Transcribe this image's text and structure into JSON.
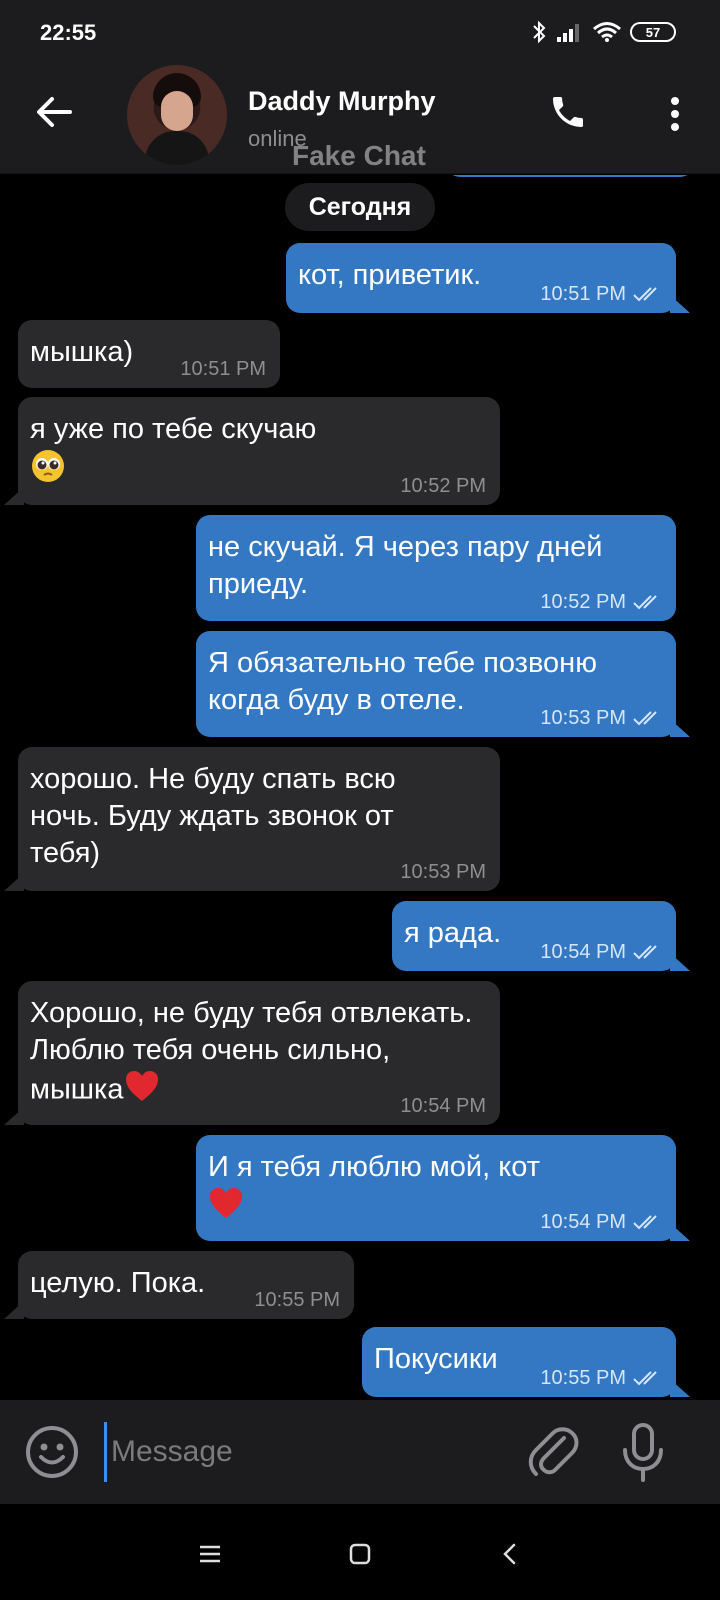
{
  "status_bar": {
    "time": "22:55",
    "battery": "57",
    "icons": [
      "bluetooth-icon",
      "signal-icon",
      "wifi-icon",
      "battery-icon"
    ]
  },
  "header": {
    "contact_name": "Daddy Murphy",
    "contact_status": "online",
    "watermark": "Fake Chat",
    "icons": [
      "back-arrow-icon",
      "phone-icon",
      "more-vert-icon"
    ]
  },
  "chat": {
    "date_label": "Сегодня",
    "colors": {
      "outgoing": "#3478c4",
      "incoming": "#2a2a2c"
    },
    "messages": [
      {
        "dir": "out",
        "text": "кот, приветик.",
        "time": "10:51 PM",
        "read": true
      },
      {
        "dir": "in",
        "text": "мышка)",
        "time": "10:51 PM"
      },
      {
        "dir": "in",
        "text": "я уже по тебе скучаю",
        "emoji": "pleading-face-emoji",
        "time": "10:52 PM"
      },
      {
        "dir": "out",
        "text": "не скучай. Я через пару дней приеду.",
        "time": "10:52 PM",
        "read": true
      },
      {
        "dir": "out",
        "text": "Я обязательно тебе позвоню когда буду в отеле.",
        "time": "10:53 PM",
        "read": true
      },
      {
        "dir": "in",
        "text": "хорошо. Не буду спать всю ночь. Буду ждать звонок от тебя)",
        "time": "10:53 PM"
      },
      {
        "dir": "out",
        "text": "я рада.",
        "time": "10:54 PM",
        "read": true
      },
      {
        "dir": "in",
        "text": "Хорошо, не буду тебя отвлекать. Люблю тебя очень сильно, мышка",
        "emoji": "red-heart-emoji",
        "time": "10:54 PM"
      },
      {
        "dir": "out",
        "text": "И я тебя люблю мой, кот",
        "emoji": "red-heart-emoji",
        "time": "10:54 PM",
        "read": true
      },
      {
        "dir": "in",
        "text": "целую. Пока.",
        "time": "10:55 PM"
      },
      {
        "dir": "out",
        "text": "Покусики",
        "time": "10:55 PM",
        "read": true
      }
    ]
  },
  "input": {
    "placeholder": "Message",
    "value": "",
    "icons": [
      "emoji-icon",
      "attach-icon",
      "microphone-icon"
    ]
  },
  "nav_bar": {
    "icons": [
      "menu-icon",
      "home-icon",
      "back-icon"
    ]
  }
}
